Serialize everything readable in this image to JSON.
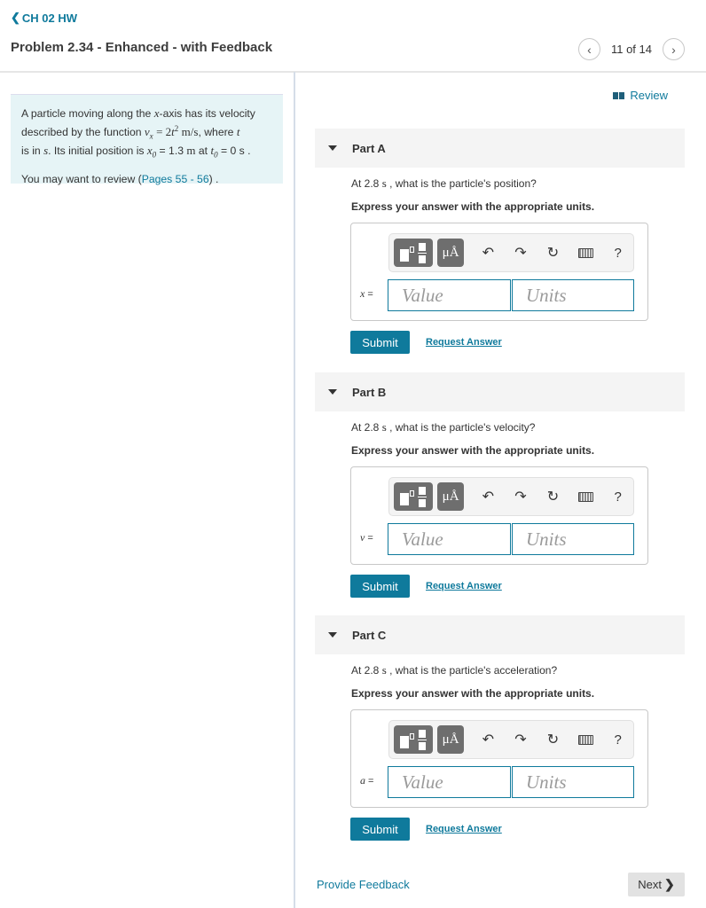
{
  "header": {
    "back_label": "CH 02 HW",
    "back_icon": "chevron-left-icon",
    "title": "Problem 2.34 - Enhanced - with Feedback",
    "pager": {
      "current": 11,
      "total": 14,
      "text": "11 of 14",
      "prev_icon": "chevron-left-icon",
      "next_icon": "chevron-right-icon"
    }
  },
  "problem": {
    "line1": "A particle moving along the ",
    "x_axis_var": "x",
    "line1b": "-axis has its velocity",
    "line2a": "described by the function ",
    "function_expr": "vx = 2t² m/s",
    "line2b": ", where ",
    "t_var": "t",
    "line3a": "is in ",
    "s_unit": "s",
    "line3b": ". Its initial position is ",
    "x0_expr": "x₀",
    "x0_value": " = 1.3 ",
    "m_unit": "m",
    "line3c": " at ",
    "t0_expr": "t₀",
    "t0_value": " = 0 s .",
    "review_prefix": "You may want to review (",
    "review_pages": "Pages 55 - 56",
    "review_suffix": ") ."
  },
  "review_link": {
    "label": "Review",
    "icon": "book-icon"
  },
  "parts": [
    {
      "label": "Part A",
      "question_prefix": "At 2.8 ",
      "question_unit": "s",
      "question_suffix": " , what is the particle's position?",
      "instruction": "Express your answer with the appropriate units.",
      "variable": "x",
      "value_placeholder": "Value",
      "units_placeholder": "Units",
      "submit_label": "Submit",
      "request_label": "Request Answer"
    },
    {
      "label": "Part B",
      "question_prefix": "At 2.8 ",
      "question_unit": "s",
      "question_suffix": " , what is the particle's velocity?",
      "instruction": "Express your answer with the appropriate units.",
      "variable": "v",
      "value_placeholder": "Value",
      "units_placeholder": "Units",
      "submit_label": "Submit",
      "request_label": "Request Answer"
    },
    {
      "label": "Part C",
      "question_prefix": "At 2.8 ",
      "question_unit": "s",
      "question_suffix": " , what is the particle's acceleration?",
      "instruction": "Express your answer with the appropriate units.",
      "variable": "a",
      "value_placeholder": "Value",
      "units_placeholder": "Units",
      "submit_label": "Submit",
      "request_label": "Request Answer"
    }
  ],
  "toolbar": {
    "units_button": "μÅ",
    "undo_icon": "↶",
    "redo_icon": "↷",
    "reset_icon": "↻",
    "help_icon": "?"
  },
  "equals": "=",
  "footer": {
    "feedback_label": "Provide Feedback",
    "next_label": "Next"
  },
  "colors": {
    "accent": "#0f7a9c",
    "problem_bg": "#e6f4f6",
    "part_header_bg": "#f4f4f4",
    "toolbar_button": "#6e6e6e"
  }
}
